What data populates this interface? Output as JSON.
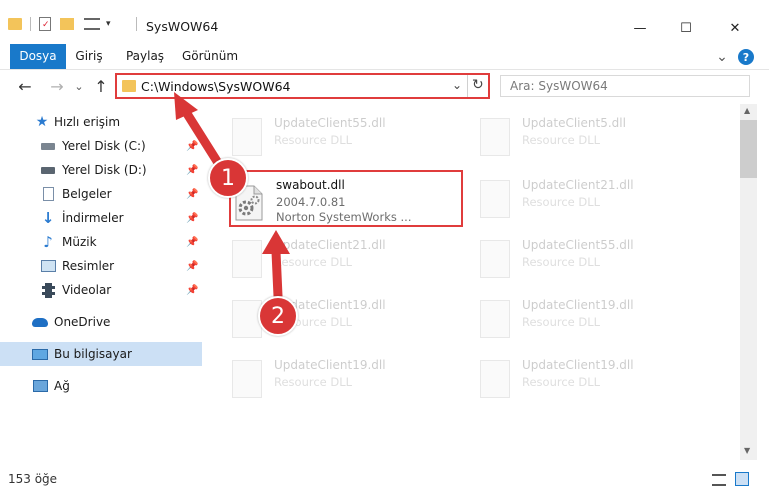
{
  "window": {
    "title": "SysWOW64",
    "minimize": "—",
    "maximize": "☐",
    "close": "✕"
  },
  "ribbon": {
    "tabs": [
      "Dosya",
      "Giriş",
      "Paylaş",
      "Görünüm"
    ],
    "active_tab": "Dosya",
    "collapse_glyph": "⌄",
    "help_glyph": "?"
  },
  "nav": {
    "back_glyph": "←",
    "forward_glyph": "→",
    "recent_glyph": "⌄",
    "up_glyph": "↑",
    "address": "C:\\Windows\\SysWOW64",
    "refresh_glyph": "↻",
    "dropdown_glyph": "⌄",
    "search_placeholder": "Ara: SysWOW64"
  },
  "sidebar": {
    "items": [
      {
        "label": "Hızlı erişim",
        "icon": "star-icon",
        "pinned": false
      },
      {
        "label": "Yerel Disk (C:)",
        "icon": "drive-icon",
        "pinned": true
      },
      {
        "label": "Yerel Disk (D:)",
        "icon": "drive-icon",
        "pinned": true
      },
      {
        "label": "Belgeler",
        "icon": "document-icon",
        "pinned": true
      },
      {
        "label": "İndirmeler",
        "icon": "download-icon",
        "pinned": true
      },
      {
        "label": "Müzik",
        "icon": "music-icon",
        "pinned": true
      },
      {
        "label": "Resimler",
        "icon": "picture-icon",
        "pinned": true
      },
      {
        "label": "Videolar",
        "icon": "video-icon",
        "pinned": true
      },
      {
        "label": "OneDrive",
        "icon": "cloud-icon",
        "pinned": false
      },
      {
        "label": "Bu bilgisayar",
        "icon": "computer-icon",
        "pinned": false,
        "selected": true
      },
      {
        "label": "Ağ",
        "icon": "network-icon",
        "pinned": false
      }
    ]
  },
  "files": {
    "selected": {
      "name": "swabout.dll",
      "version": "2004.7.0.81",
      "description": "Norton SystemWorks ..."
    },
    "faded": [
      {
        "name": "UpdateClient55.dll",
        "type": "Resource DLL"
      },
      {
        "name": "UpdateClient5.dll",
        "type": "Resource DLL"
      },
      {
        "name": "UpdateClient21.dll",
        "type": "Resource DLL"
      },
      {
        "name": "UpdateClient21.dll",
        "type": "Resource DLL"
      },
      {
        "name": "UpdateClient55.dll",
        "type": "Resource DLL"
      },
      {
        "name": "UpdateClient19.dll",
        "type": "Resource DLL"
      },
      {
        "name": "UpdateClient19.dll",
        "type": "Resource DLL"
      },
      {
        "name": "UpdateClient19.dll",
        "type": "Resource DLL"
      },
      {
        "name": "UpdateClient19.dll",
        "type": "Resource DLL"
      }
    ]
  },
  "status": {
    "item_count": "153 öğe"
  },
  "annotations": {
    "badge1": "1",
    "badge2": "2"
  },
  "colors": {
    "accent": "#1979ca",
    "highlight": "#e03c3c",
    "badge": "#d93636",
    "selected_bg": "#cce0f5"
  }
}
